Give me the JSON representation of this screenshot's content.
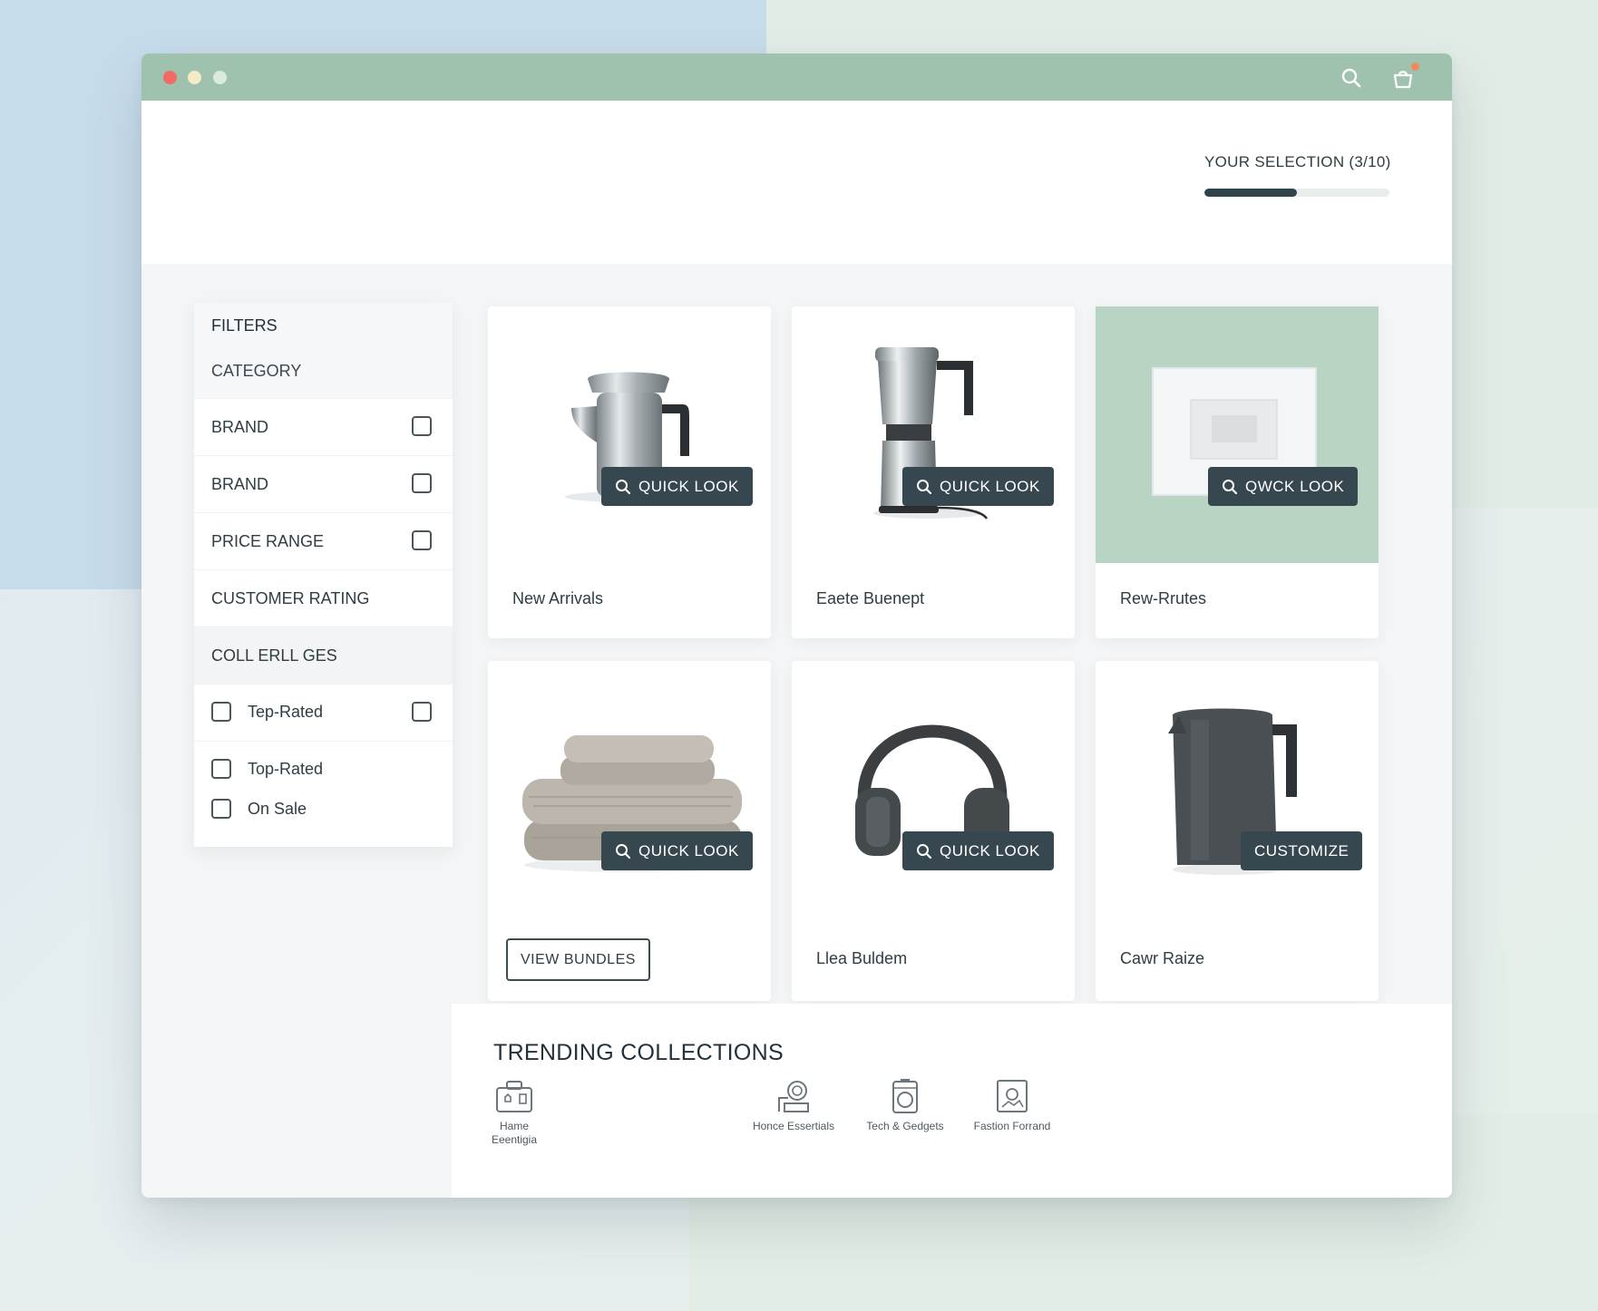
{
  "window": {
    "controls": [
      "close",
      "minimize",
      "maximize"
    ],
    "toolbar_icons": [
      "search-icon",
      "cart-icon"
    ],
    "colors": {
      "titlebar": "#9fc2af",
      "accent_dark": "#37474f",
      "cart_badge": "#f08a5d"
    }
  },
  "header": {
    "selection_label": "YOUR SELECTION (3/10)",
    "selection_current": 3,
    "selection_total": 10,
    "progress_fraction": 0.5
  },
  "filters": {
    "title": "FILTERS",
    "category_label": "CATEGORY",
    "rows": [
      {
        "label": "BRAND",
        "checked": false
      },
      {
        "label": "BRAND",
        "checked": false
      },
      {
        "label": "PRICE RANGE",
        "checked": false
      },
      {
        "label": "CUSTOMER RATING"
      },
      {
        "label": "COLL ERLL GES"
      }
    ],
    "options": [
      {
        "label": "Tep-Rated",
        "checked": false
      },
      {
        "label": "Top-Rated",
        "checked": false
      },
      {
        "label": "On Sale",
        "checked": false
      }
    ]
  },
  "products": [
    {
      "title": "New Arrivals",
      "image": "coffee-kettle-image",
      "action": "QUICK LOOK"
    },
    {
      "title": "Eaete Buenept",
      "image": "coffee-maker-image",
      "action": "QUICK LOOK"
    },
    {
      "title": "Rew-Rrutes",
      "image": "picture-frame-image",
      "action": "QWCK LOOK"
    },
    {
      "title": "",
      "image": "towels-image",
      "action": "QUICK LOOK",
      "secondary_action": "VIEW BUNDLES"
    },
    {
      "title": "Llea Buldem",
      "image": "headphones-image",
      "action": "QUICK LOOK"
    },
    {
      "title": "Cawr Raize",
      "image": "electric-kettle-image",
      "action": "CUSTOMIZE"
    }
  ],
  "trending": {
    "title": "TRENDING COLLECTIONS",
    "items": [
      {
        "label_line1": "Hame",
        "label_line2": "Eeentigia",
        "icon": "home-box-icon"
      },
      {
        "label_line1": "Honce Essertials",
        "label_line2": "",
        "icon": "person-badge-icon"
      },
      {
        "label_line1": "Tech & Gedgets",
        "label_line2": "",
        "icon": "washer-icon"
      },
      {
        "label_line1": "Fastion Forrand",
        "label_line2": "",
        "icon": "photo-frame-icon"
      }
    ]
  }
}
